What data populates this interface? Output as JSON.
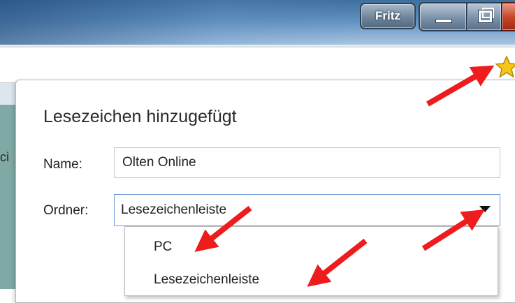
{
  "titlebar": {
    "profile_label": "Fritz"
  },
  "dialog": {
    "title": "Lesezeichen hinzugefügt",
    "name_label": "Name:",
    "name_value": "Olten Online",
    "folder_label": "Ordner:",
    "folder_value": "Lesezeichenleiste",
    "folder_options": [
      "PC",
      "Lesezeichenleiste"
    ]
  },
  "background": {
    "clipped_text": "ci"
  },
  "colors": {
    "annotation_arrow": "#ee1c1c",
    "star": "#f5c518",
    "select_focus_border": "#6e98d6"
  },
  "icons": {
    "star": "star-icon",
    "minimize": "minimize-icon",
    "maximize": "maximize-icon",
    "close": "close-icon",
    "dropdown": "chevron-down-icon"
  }
}
